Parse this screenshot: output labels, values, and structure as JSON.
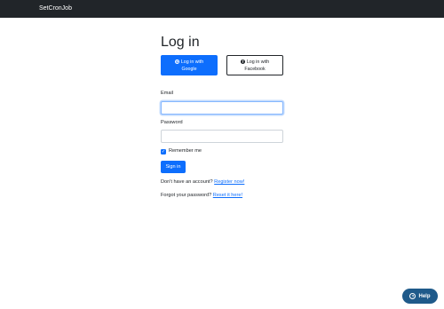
{
  "navbar": {
    "brand": "SetCronJob"
  },
  "page": {
    "title": "Log in"
  },
  "social": {
    "google_line1": "Log in with",
    "google_line2": "Google",
    "facebook_line1": "Log in with",
    "facebook_line2": "Facebook"
  },
  "form": {
    "email_label": "Email",
    "email_value": "",
    "password_label": "Password",
    "password_value": "",
    "remember_label": "Remember me",
    "remember_checked": true,
    "signin_label": "Sign in"
  },
  "links": {
    "no_account_text": "Don't have an account?",
    "register_label": "Register now!",
    "forgot_text": "Forgot your password?",
    "reset_label": "Reset it here!"
  },
  "help": {
    "label": "Help"
  },
  "colors": {
    "navbar": "#212529",
    "primary": "#0d6efd",
    "help": "#1f5a8a"
  },
  "icons": {
    "google": "google-icon",
    "facebook": "facebook-icon",
    "help": "help-icon",
    "check": "check-icon"
  }
}
